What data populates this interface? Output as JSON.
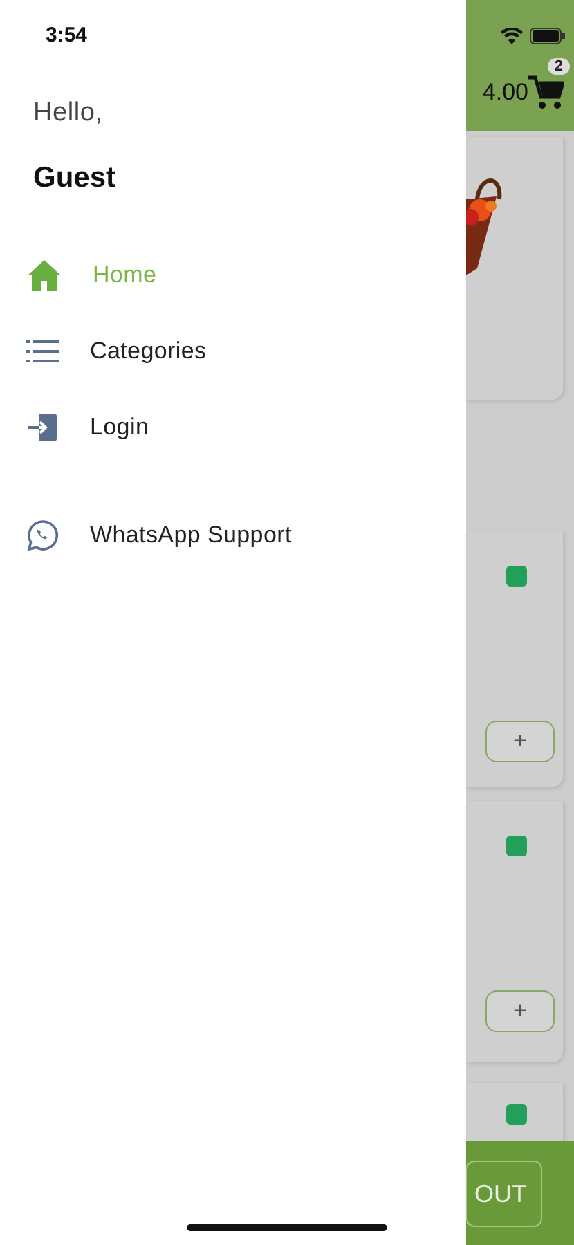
{
  "status_bar": {
    "time": "3:54"
  },
  "drawer": {
    "greeting": "Hello,",
    "user_name": "Guest",
    "items": [
      {
        "kind": "home",
        "label": "Home",
        "selected": true
      },
      {
        "kind": "list",
        "label": "Categories",
        "selected": false
      },
      {
        "kind": "login",
        "label": "Login",
        "selected": false
      },
      {
        "kind": "whatsapp",
        "label": "WhatsApp Support",
        "selected": false
      }
    ]
  },
  "background": {
    "header": {
      "total": "4.00",
      "cart_count": "2"
    },
    "products": [
      {
        "kind": "picture"
      },
      {
        "kind": "item",
        "add_label": "+"
      },
      {
        "kind": "item",
        "add_label": "+"
      },
      {
        "kind": "partial"
      }
    ],
    "checkout": "OUT"
  }
}
